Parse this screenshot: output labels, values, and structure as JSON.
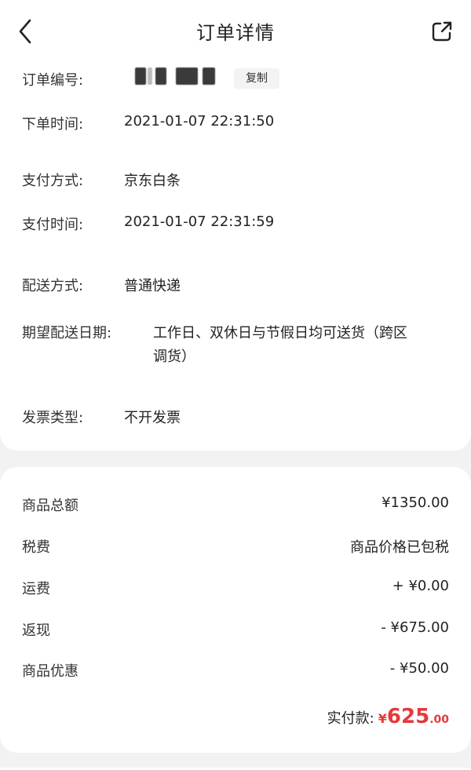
{
  "header": {
    "title": "订单详情",
    "back_icon": "chevron-left-icon",
    "share_icon": "share-icon"
  },
  "order_info": {
    "order_number_label": "订单编号:",
    "copy_label": "复制",
    "order_time_label": "下单时间:",
    "order_time_value": "2021-01-07 22:31:50",
    "payment_method_label": "支付方式:",
    "payment_method_value": "京东白条",
    "payment_time_label": "支付时间:",
    "payment_time_value": "2021-01-07 22:31:59",
    "delivery_method_label": "配送方式:",
    "delivery_method_value": "普通快递",
    "expected_delivery_label": "期望配送日期:",
    "expected_delivery_line1": "工作日、双休日与节假日均可送货（跨区",
    "expected_delivery_line2": "调货）",
    "invoice_type_label": "发票类型:",
    "invoice_type_value": "不开发票"
  },
  "summary": {
    "goods_total_label": "商品总额",
    "goods_total_value": "¥1350.00",
    "tax_label": "税费",
    "tax_value": "商品价格已包税",
    "shipping_label": "运费",
    "shipping_value": "+ ¥0.00",
    "cashback_label": "返现",
    "cashback_value": "- ¥675.00",
    "discount_label": "商品优惠",
    "discount_value": "- ¥50.00",
    "paid_label": "实付款:",
    "paid_currency": "¥",
    "paid_integer": "625",
    "paid_decimal": ".00"
  },
  "colors": {
    "accent_red": "#e4393c",
    "card_bg": "#ffffff",
    "page_bg": "#f2f2f2"
  }
}
